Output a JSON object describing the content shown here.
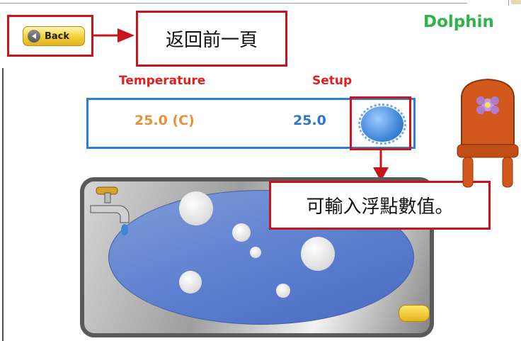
{
  "header": {
    "title": "Dolphin"
  },
  "toolbar": {
    "back_label": "Back"
  },
  "annotations": {
    "back_callout": "返回前一頁",
    "setup_callout": "可輸入浮點數值。"
  },
  "display": {
    "temperature_label": "Temperature",
    "setup_label": "Setup",
    "temperature_value": "25.0 (C)",
    "setup_value": "25.0"
  },
  "colors": {
    "highlight": "#c8141c",
    "title_green": "#2db34a",
    "label_red": "#e02020",
    "panel_blue": "#2b7fd6",
    "temp_orange": "#e39438",
    "setup_blue": "#2e74c9"
  },
  "icons": {
    "back": "left-arrow-icon",
    "setup": "circle-button-icon",
    "faucet": "faucet-icon",
    "chair": "chair-icon",
    "soap": "soap-icon"
  }
}
